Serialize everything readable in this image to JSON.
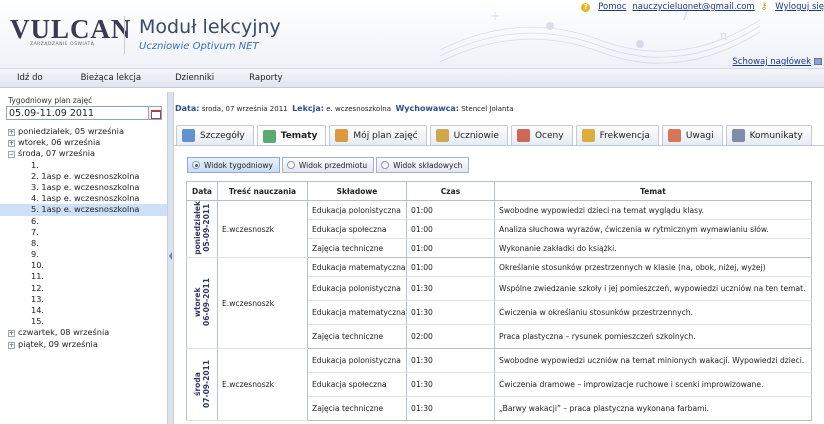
{
  "header": {
    "logo_text": "VULCAN",
    "logo_tagline": "ZARZĄDZANIE OŚWIATĄ",
    "app_title": "Moduł lekcyjny",
    "app_subtitle": "Uczniowie Optivum NET",
    "help_label": "Pomoc",
    "user_email": "nauczycieluonet@gmail.com",
    "logout_label": "Wyloguj się",
    "hide_header_label": "Schowaj nagłówek"
  },
  "menu": [
    "Idź do",
    "Bieżąca lekcja",
    "Dzienniki",
    "Raporty"
  ],
  "sidebar": {
    "week_label": "Tygodniowy plan zajęć",
    "week_value": "05.09-11.09 2011",
    "tree": [
      {
        "type": "day",
        "expander": "+",
        "label": "poniedziałek, 05 września"
      },
      {
        "type": "day",
        "expander": "+",
        "label": "wtorek, 06 września"
      },
      {
        "type": "day",
        "expander": "−",
        "label": "środa, 07 września"
      },
      {
        "type": "lesson",
        "label": "1."
      },
      {
        "type": "lesson",
        "label": "2. 1asp e. wczesnoszkolna"
      },
      {
        "type": "lesson",
        "label": "3. 1asp e. wczesnoszkolna"
      },
      {
        "type": "lesson",
        "label": "4. 1asp e. wczesnoszkolna"
      },
      {
        "type": "lesson",
        "label": "5. 1asp e. wczesnoszkolna",
        "selected": true
      },
      {
        "type": "lesson",
        "label": "6."
      },
      {
        "type": "lesson",
        "label": "7."
      },
      {
        "type": "lesson",
        "label": "8."
      },
      {
        "type": "lesson",
        "label": "9."
      },
      {
        "type": "lesson",
        "label": "10."
      },
      {
        "type": "lesson",
        "label": "11."
      },
      {
        "type": "lesson",
        "label": "12."
      },
      {
        "type": "lesson",
        "label": "13."
      },
      {
        "type": "lesson",
        "label": "14."
      },
      {
        "type": "lesson",
        "label": "15."
      },
      {
        "type": "day",
        "expander": "+",
        "label": "czwartek, 08 września"
      },
      {
        "type": "day",
        "expander": "+",
        "label": "piątek, 09 września"
      }
    ]
  },
  "info": {
    "data_label": "Data:",
    "data_value": "środa, 07 września 2011",
    "lekcja_label": "Lekcja:",
    "lekcja_value": "e. wczesnoszkolna",
    "wychowawca_label": "Wychowawca:",
    "wychowawca_value": "Stencel Jolanta"
  },
  "tabs": [
    {
      "label": "Szczegóły",
      "icon": "magnifier-icon",
      "color": "#4a7fc8",
      "active": false
    },
    {
      "label": "Tematy",
      "icon": "topics-icon",
      "color": "#3e9a5a",
      "active": true
    },
    {
      "label": "Mój plan zajęć",
      "icon": "schedule-icon",
      "color": "#d68a1e",
      "active": false
    },
    {
      "label": "Uczniowie",
      "icon": "students-icon",
      "color": "#c89a2e",
      "active": false
    },
    {
      "label": "Oceny",
      "icon": "grades-icon",
      "color": "#c8503a",
      "active": false
    },
    {
      "label": "Frekwencja",
      "icon": "attendance-icon",
      "color": "#d7a21c",
      "active": false
    },
    {
      "label": "Uwagi",
      "icon": "notes-icon",
      "color": "#d0603a",
      "active": false
    },
    {
      "label": "Komunikaty",
      "icon": "messages-icon",
      "color": "#6a7a9a",
      "active": false
    }
  ],
  "views": [
    {
      "label": "Widok tygodniowy",
      "active": true
    },
    {
      "label": "Widok przedmiotu",
      "active": false
    },
    {
      "label": "Widok składowych",
      "active": false
    }
  ],
  "table": {
    "headers": [
      "Data",
      "Treść nauczania",
      "Składowe",
      "Czas",
      "Temat"
    ],
    "groups": [
      {
        "date_line1": "poniedziałek",
        "date_line2": "05-09-2011",
        "subject": "E.wczesnoszk",
        "rows": [
          {
            "component": "Edukacja polonistyczna",
            "time": "01:00",
            "topic": "Swobodne wypowiedzi dzieci na temat wyglądu klasy."
          },
          {
            "component": "Edukacja społeczna",
            "time": "01:00",
            "topic": "Analiza słuchowa wyrazów, ćwiczenia w rytmicznym wymawianiu słów."
          },
          {
            "component": "Zajęcia techniczne",
            "time": "01:00",
            "topic": "Wykonanie zakładki do książki."
          }
        ]
      },
      {
        "date_line1": "wtorek",
        "date_line2": "06-09-2011",
        "subject": "E.wczesnoszk",
        "rows": [
          {
            "component": "Edukacja matematyczna",
            "time": "01:00",
            "topic": "Określanie stosunków przestrzennych w klasie (na, obok, niżej, wyżej)"
          },
          {
            "component": "Edukacja polonistyczna",
            "time": "01:30",
            "topic": "Wspólne zwiedzanie szkoły i jej pomieszczeń, wypowiedzi uczniów na ten temat."
          },
          {
            "component": "Edukacja matematyczna",
            "time": "01:30",
            "topic": "Ćwiczenia w określaniu stosunków przestrzennych."
          },
          {
            "component": "Zajęcia techniczne",
            "time": "02:00",
            "topic": "Praca plastyczna – rysunek pomieszczeń szkolnych."
          }
        ]
      },
      {
        "date_line1": "środa",
        "date_line2": "07-09-2011",
        "subject": "E.wczesnoszk",
        "rows": [
          {
            "component": "Edukacja polonistyczna",
            "time": "01:30",
            "topic": "Swobodne wypowiedzi uczniów na temat minionych wakacji. Wypowiedzi dzieci."
          },
          {
            "component": "Edukacja społeczna",
            "time": "01:30",
            "topic": "Ćwiczenia dramowe – improwizacje ruchowe i scenki improwizowane."
          },
          {
            "component": "Zajęcia techniczne",
            "time": "01:30",
            "topic": "„Barwy wakacji” – praca plastyczna wykonana farbami."
          }
        ]
      }
    ]
  }
}
